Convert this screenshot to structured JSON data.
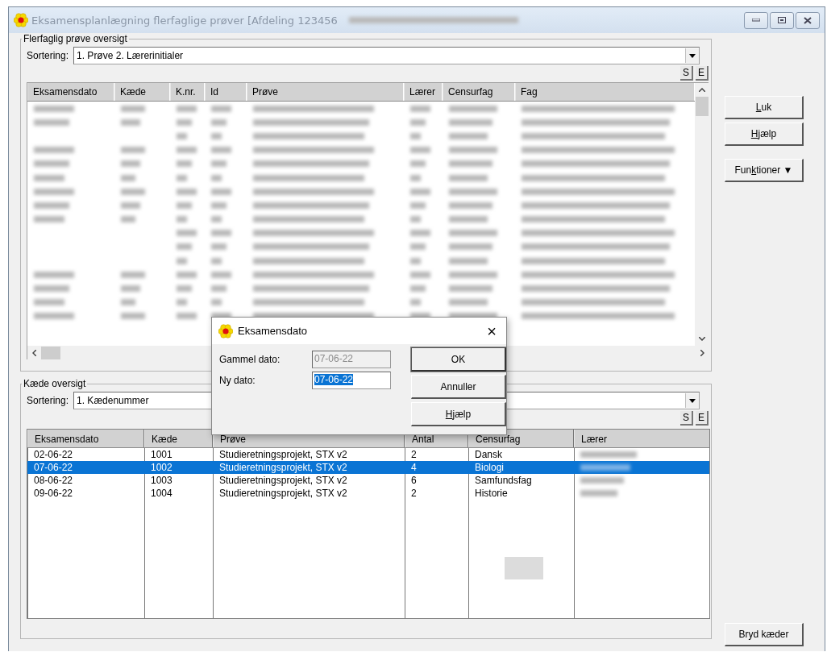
{
  "window": {
    "title": "Eksamensplanlægning flerfaglige prøver [Afdeling 123456"
  },
  "upper_group": {
    "title": "Flerfaglig prøve oversigt",
    "sort_label": "Sortering:",
    "sort_value": "1. Prøve  2. Lærerinitialer",
    "s_button": "S",
    "e_button": "E",
    "columns": [
      "Eksamensdato",
      "Kæde",
      "K.nr.",
      "Id",
      "Prøve",
      "Lærer",
      "Censurfag",
      "Fag"
    ],
    "rows": [
      {
        "kind": "full"
      },
      {
        "kind": "full"
      },
      {
        "kind": "partial"
      },
      {
        "kind": "full"
      },
      {
        "kind": "full"
      },
      {
        "kind": "full"
      },
      {
        "kind": "full"
      },
      {
        "kind": "full"
      },
      {
        "kind": "full"
      },
      {
        "kind": "partial"
      },
      {
        "kind": "partial"
      },
      {
        "kind": "partial"
      },
      {
        "kind": "full"
      },
      {
        "kind": "full"
      },
      {
        "kind": "full"
      },
      {
        "kind": "full"
      }
    ]
  },
  "side_buttons": [
    {
      "accel": "L",
      "after": "uk",
      "kind": "plain"
    },
    {
      "accel": "H",
      "after": "jælp",
      "kind": "plain"
    },
    {
      "before": "Fun",
      "accel": "k",
      "after": "tioner",
      "kind": "menu",
      "arrow": "▼"
    }
  ],
  "lower_group": {
    "title": "Kæde oversigt",
    "sort_label": "Sortering:",
    "sort_value": "1. Kædenummer",
    "s_button": "S",
    "e_button": "E",
    "columns": [
      "Eksamensdato",
      "Kæde",
      "Prøve",
      "Antal",
      "Censurfag",
      "Lærer"
    ],
    "rows": [
      {
        "cells": [
          "02-06-22",
          "1001",
          "Studieretningsprojekt, STX v2",
          "2",
          "Dansk"
        ],
        "selected": false
      },
      {
        "cells": [
          "07-06-22",
          "1002",
          "Studieretningsprojekt, STX v2",
          "4",
          "Biologi"
        ],
        "selected": true
      },
      {
        "cells": [
          "08-06-22",
          "1003",
          "Studieretningsprojekt, STX v2",
          "6",
          "Samfundsfag"
        ],
        "selected": false
      },
      {
        "cells": [
          "09-06-22",
          "1004",
          "Studieretningsprojekt, STX v2",
          "2",
          "Historie"
        ],
        "selected": false
      }
    ]
  },
  "break_button": "Bryd kæder",
  "dialog": {
    "title": "Eksamensdato",
    "close": "×",
    "old_label": "Gammel dato:",
    "old_value": "07-06-22",
    "old_disabled": true,
    "new_label": "Ny dato:",
    "new_value": "07-06-22",
    "new_selected": true,
    "buttons": [
      {
        "before": "OK",
        "default": true
      },
      {
        "before": "Annuller",
        "default": false
      },
      {
        "accel": "H",
        "after": "jælp",
        "default": false
      }
    ]
  }
}
